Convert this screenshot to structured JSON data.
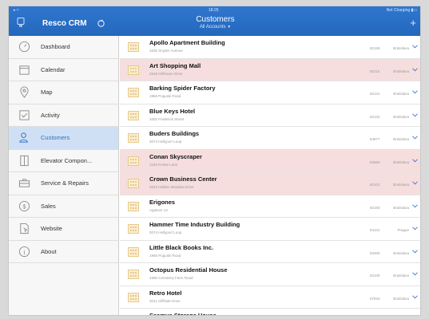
{
  "status": {
    "left": "▸ ≈",
    "time": "18:25",
    "right": "Not Charging ▮▭"
  },
  "app": {
    "title": "Resco CRM"
  },
  "header": {
    "title": "Customers",
    "subtitle": "All Accounts",
    "add": "+"
  },
  "sidebar": {
    "items": [
      {
        "label": "Dashboard",
        "icon": "gauge-icon"
      },
      {
        "label": "Calendar",
        "icon": "calendar-icon"
      },
      {
        "label": "Map",
        "icon": "map-pin-icon"
      },
      {
        "label": "Activity",
        "icon": "checklist-icon"
      },
      {
        "label": "Customers",
        "icon": "customers-icon"
      },
      {
        "label": "Elevator Compon...",
        "icon": "elevator-icon"
      },
      {
        "label": "Service & Repairs",
        "icon": "toolbox-icon"
      },
      {
        "label": "Sales",
        "icon": "dollar-icon"
      },
      {
        "label": "Website",
        "icon": "website-icon"
      },
      {
        "label": "About",
        "icon": "info-icon"
      }
    ]
  },
  "customers": [
    {
      "name": "Apollo Apartment Building",
      "address": "1635 Snyder Avenue",
      "zip": "82159",
      "city": "Bratislava",
      "highlighted": false
    },
    {
      "name": "Art Shopping Mall",
      "address": "2525 Hillhaven Drive",
      "zip": "82115",
      "city": "Bratislava",
      "highlighted": true
    },
    {
      "name": "Barking Spider Factory",
      "address": "1966 Poguski Road",
      "zip": "82131",
      "city": "Bratislava",
      "highlighted": false
    },
    {
      "name": "Blue Keys Hotel",
      "address": "3302 Frederick Street",
      "zip": "82132",
      "city": "Bratislava",
      "highlighted": false
    },
    {
      "name": "Buders Buildings",
      "address": "3074 Hellyport Loop",
      "zip": "84877",
      "city": "Bratislava",
      "highlighted": false
    },
    {
      "name": "Conan Skyscraper",
      "address": "2183 Pointe Lane",
      "zip": "84565",
      "city": "Bratislava",
      "highlighted": true
    },
    {
      "name": "Crown Business Center",
      "address": "3610 Hidden Meadow Drive",
      "zip": "82101",
      "city": "Bratislava",
      "highlighted": true
    },
    {
      "name": "Erigones",
      "address": "Agatove 13",
      "zip": "82160",
      "city": "Bratislava",
      "highlighted": false
    },
    {
      "name": "Hammer Time Industry Building",
      "address": "3074 Hellyport Loop",
      "zip": "84101",
      "city": "Prague",
      "highlighted": false
    },
    {
      "name": "Little Black Books Inc.",
      "address": "1966 Poguski Road",
      "zip": "83306",
      "city": "Bratislava",
      "highlighted": false
    },
    {
      "name": "Octopus Residential House",
      "address": "4396 Cemetery Farm Road",
      "zip": "82109",
      "city": "Bratislava",
      "highlighted": false
    },
    {
      "name": "Retro Hotel",
      "address": "3011 Cliffside Drive",
      "zip": "87833",
      "city": "Bratislava",
      "highlighted": false
    },
    {
      "name": "Seamus Storage House",
      "address": "",
      "zip": "",
      "city": "",
      "highlighted": false
    }
  ],
  "colors": {
    "accent": "#2a6cc6",
    "highlight_row": "#f6dede",
    "active_nav": "#cfe0f5"
  }
}
